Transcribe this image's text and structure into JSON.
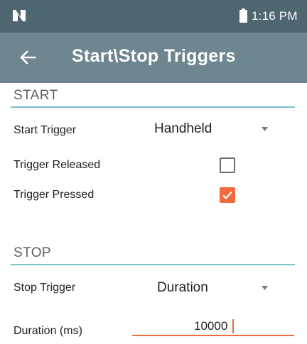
{
  "status_bar": {
    "time": "1:16 PM",
    "logo_icon": "n-logo-icon",
    "battery_icon": "battery-icon"
  },
  "app_bar": {
    "title": "Start\\Stop Triggers",
    "back_icon": "arrow-back-icon"
  },
  "start_section": {
    "header": "START",
    "start_trigger_label": "Start Trigger",
    "start_trigger_value": "Handheld",
    "trigger_released_label": "Trigger Released",
    "trigger_released_checked": false,
    "trigger_pressed_label": "Trigger Pressed",
    "trigger_pressed_checked": true
  },
  "stop_section": {
    "header": "STOP",
    "stop_trigger_label": "Stop Trigger",
    "stop_trigger_value": "Duration",
    "duration_label": "Duration (ms)",
    "duration_value": "10000"
  },
  "colors": {
    "status_bar": "#4d6670",
    "app_bar": "#6e868f",
    "accent": "#f26a3d",
    "divider": "#78c3cc"
  }
}
